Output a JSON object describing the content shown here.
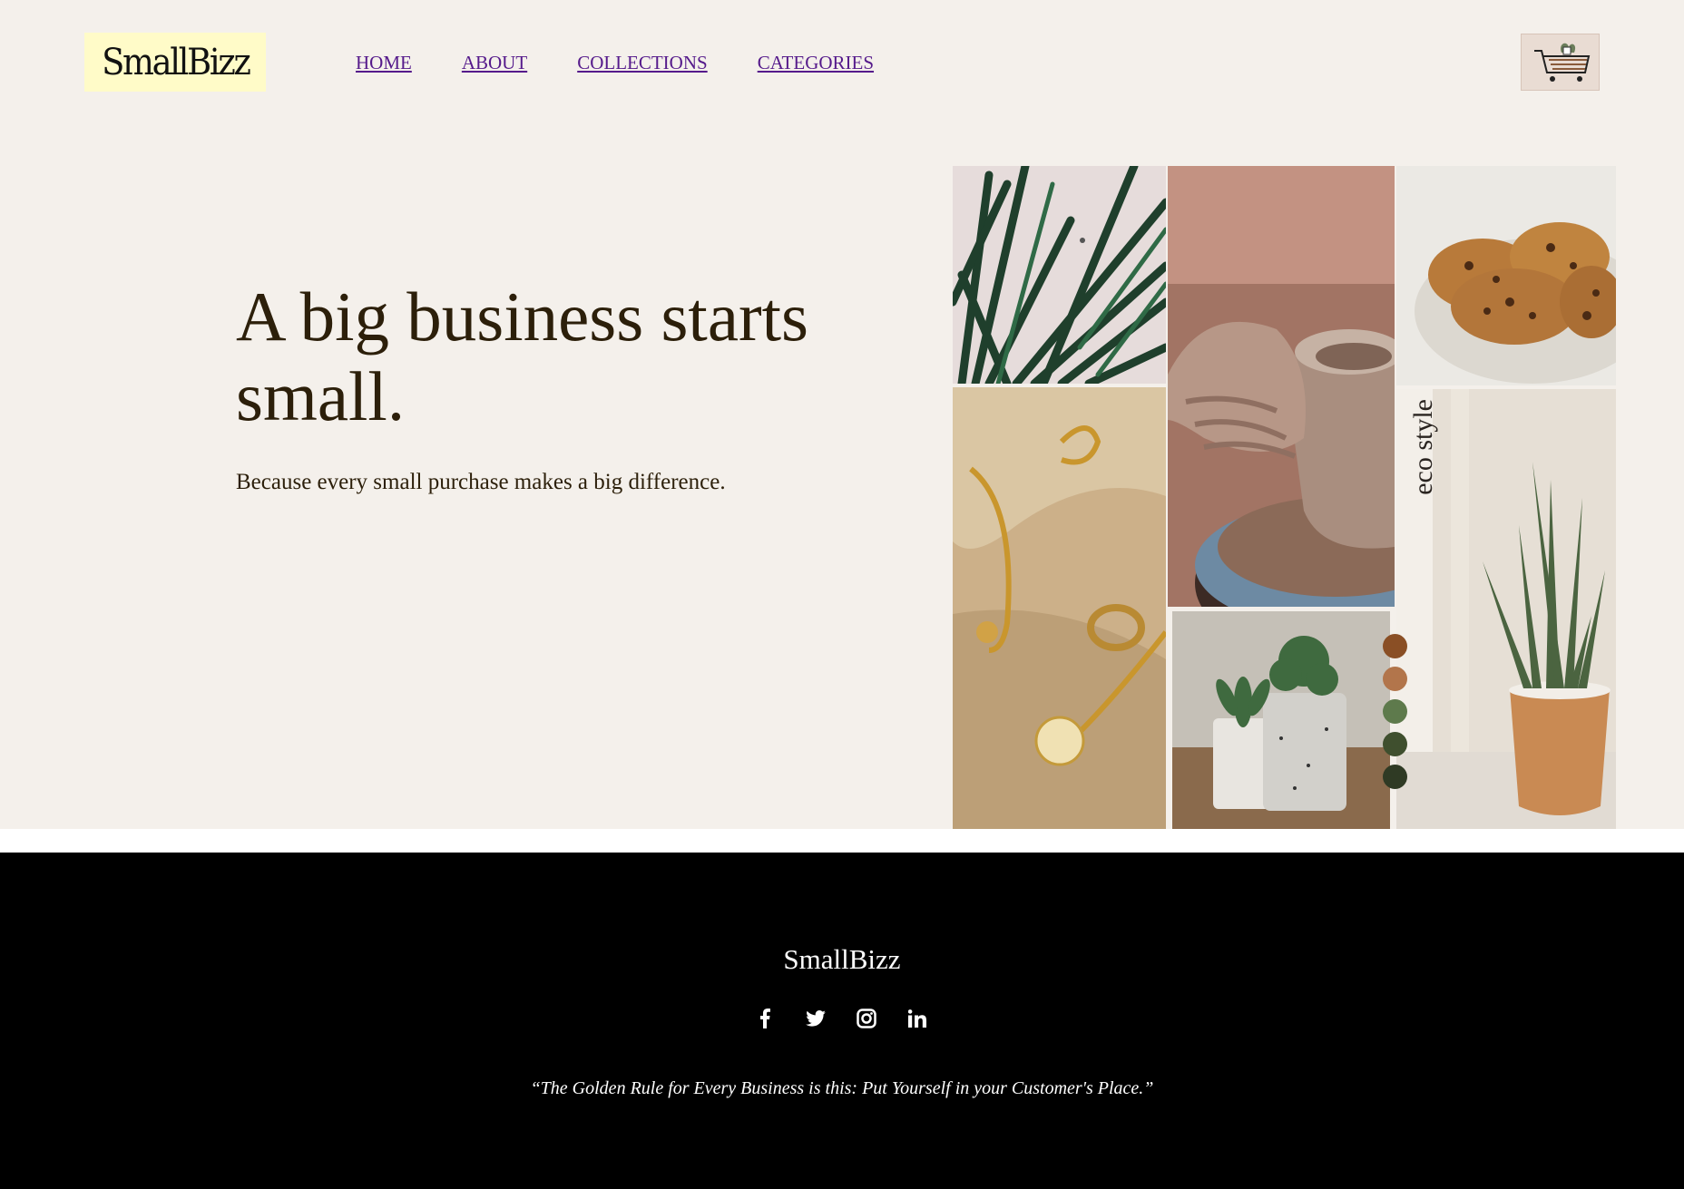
{
  "header": {
    "logo": "SmallBizz",
    "nav": [
      "HOME",
      "ABOUT",
      "COLLECTIONS",
      "CATEGORIES"
    ],
    "cart_icon": "cart-icon"
  },
  "hero": {
    "title": "A big business starts small.",
    "subtitle": "Because every small purchase makes a big difference."
  },
  "collage": {
    "label": "eco style",
    "palette": [
      "#8a4f25",
      "#b2754b",
      "#5e7a4c",
      "#3f4f2e",
      "#2f3a24"
    ]
  },
  "footer": {
    "brand": "SmallBizz",
    "socials": [
      "facebook-icon",
      "twitter-icon",
      "instagram-icon",
      "linkedin-icon"
    ],
    "quote": "“The Golden Rule for Every Business is this: Put Yourself in your Customer's Place.”"
  }
}
